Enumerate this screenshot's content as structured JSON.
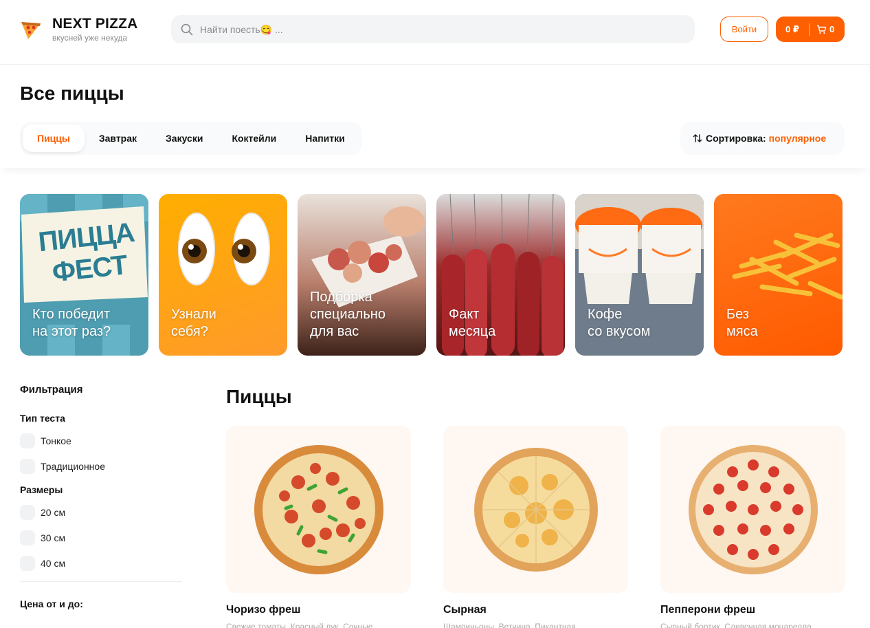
{
  "header": {
    "logo_title": "NEXT PIZZA",
    "logo_subtitle": "вкусней уже некуда",
    "search_placeholder": "Найти поесть😋 ...",
    "login_label": "Войти",
    "cart_price": "0 ₽",
    "cart_count": "0",
    "accent_color": "#fe5f00"
  },
  "page_title": "Все пиццы",
  "categories": [
    {
      "label": "Пиццы",
      "active": true
    },
    {
      "label": "Завтрак",
      "active": false
    },
    {
      "label": "Закуски",
      "active": false
    },
    {
      "label": "Коктейли",
      "active": false
    },
    {
      "label": "Напитки",
      "active": false
    }
  ],
  "sort": {
    "label": "Сортировка:",
    "value": "популярное"
  },
  "stories": [
    {
      "text": "Кто победит\nна этот раз?",
      "badge": "ПИЦЦА ФЕСТ"
    },
    {
      "text": "Узнали\nсебя?"
    },
    {
      "text": "Подборка\nспециально\nдля вас"
    },
    {
      "text": "Факт\nмесяца"
    },
    {
      "text": "Кофе\nсо вкусом"
    },
    {
      "text": "Без\nмяса"
    }
  ],
  "filters": {
    "title": "Фильтрация",
    "dough_title": "Тип теста",
    "dough_options": [
      "Тонкое",
      "Традиционное"
    ],
    "sizes_title": "Размеры",
    "size_options": [
      "20 см",
      "30 см",
      "40 см"
    ],
    "price_title": "Цена от и до:"
  },
  "section_title": "Пиццы",
  "products": [
    {
      "name": "Чоризо фреш",
      "description": "Свежие томаты, Красный лук, Сочные"
    },
    {
      "name": "Сырная",
      "description": "Шампиньоны, Ветчина, Пикантная"
    },
    {
      "name": "Пепперони фреш",
      "description": "Сырный бортик, Сливочная моцарелла"
    }
  ]
}
